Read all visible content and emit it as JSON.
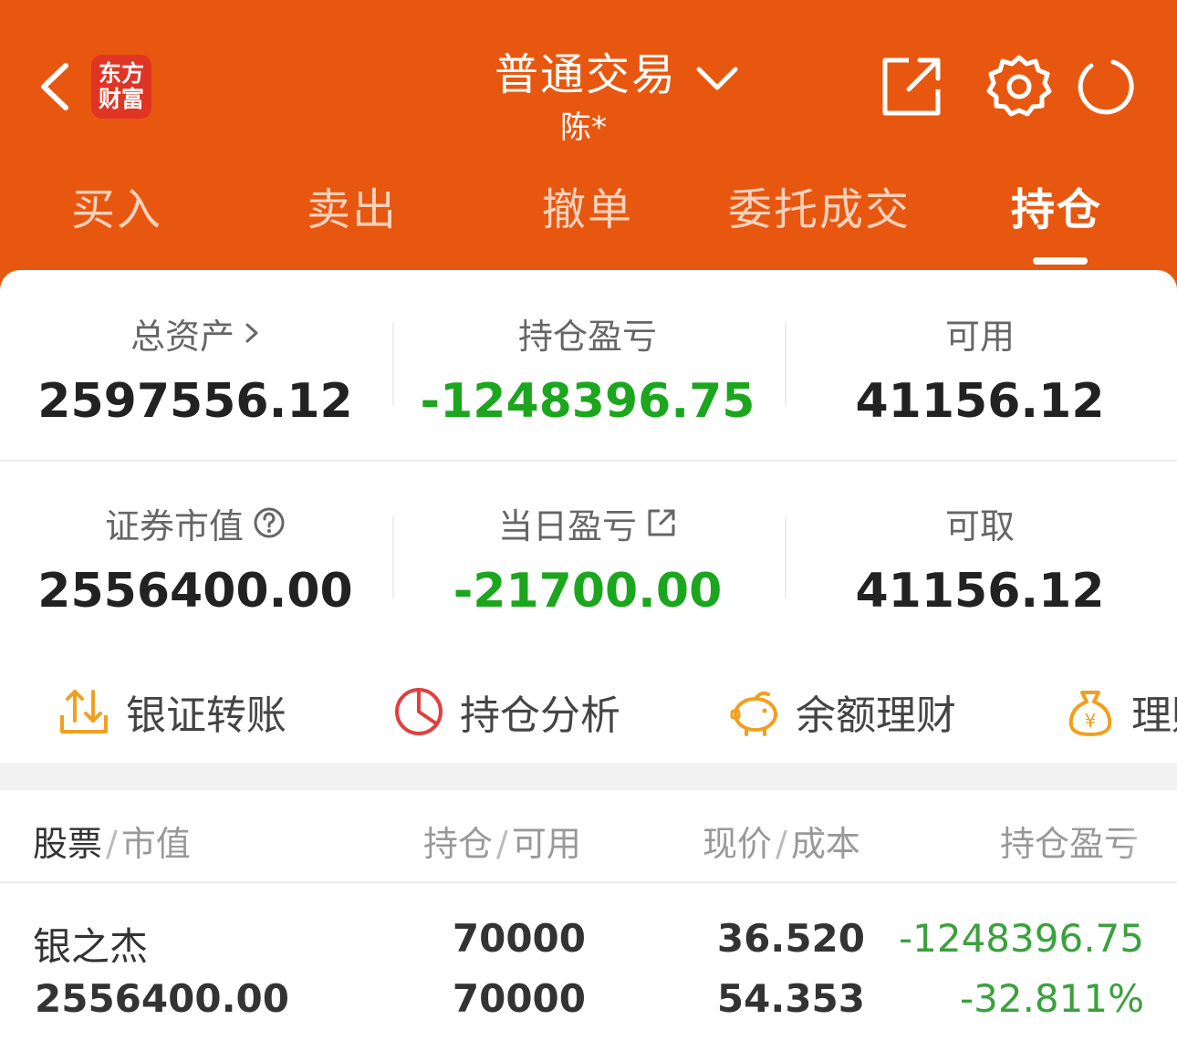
{
  "header": {
    "logo_top": "东方",
    "logo_bottom": "财富",
    "title": "普通交易",
    "account_name": "陈*",
    "colors": {
      "primary": "#e8570f",
      "logo_bg": "#e03424"
    },
    "icons": [
      "back-arrow-icon",
      "share-icon",
      "gear-icon",
      "refresh-icon",
      "chevron-down-icon"
    ]
  },
  "tabs": [
    {
      "label": "买入",
      "active": false
    },
    {
      "label": "卖出",
      "active": false
    },
    {
      "label": "撤单",
      "active": false
    },
    {
      "label": "委托成交",
      "active": false
    },
    {
      "label": "持仓",
      "active": true
    }
  ],
  "summary": {
    "total_assets": {
      "label": "总资产",
      "value": "2597556.12"
    },
    "position_pnl": {
      "label": "持仓盈亏",
      "value": "-1248396.75"
    },
    "available": {
      "label": "可用",
      "value": "41156.12"
    },
    "market_value": {
      "label": "证券市值",
      "value": "2556400.00"
    },
    "daily_pnl": {
      "label": "当日盈亏",
      "value": "-21700.00"
    },
    "withdrawable": {
      "label": "可取",
      "value": "41156.12"
    },
    "colors": {
      "loss": "#1ba61e"
    }
  },
  "quick_actions": [
    {
      "label": "银证转账",
      "icon": "transfer-icon"
    },
    {
      "label": "持仓分析",
      "icon": "pie-chart-icon"
    },
    {
      "label": "余额理财",
      "icon": "piggy-bank-icon"
    },
    {
      "label": "理财",
      "icon": "money-bag-icon"
    }
  ],
  "table": {
    "headers": {
      "stock": "股票",
      "stock_sub": "市值",
      "position": "持仓",
      "position_sub": "可用",
      "price": "现价",
      "price_sub": "成本",
      "pnl": "持仓盈亏"
    },
    "rows": [
      {
        "name": "银之杰",
        "market_value": "2556400.00",
        "position": "70000",
        "available": "70000",
        "price": "36.520",
        "cost": "54.353",
        "pnl": "-1248396.75",
        "pnl_pct": "-32.811%"
      }
    ]
  }
}
